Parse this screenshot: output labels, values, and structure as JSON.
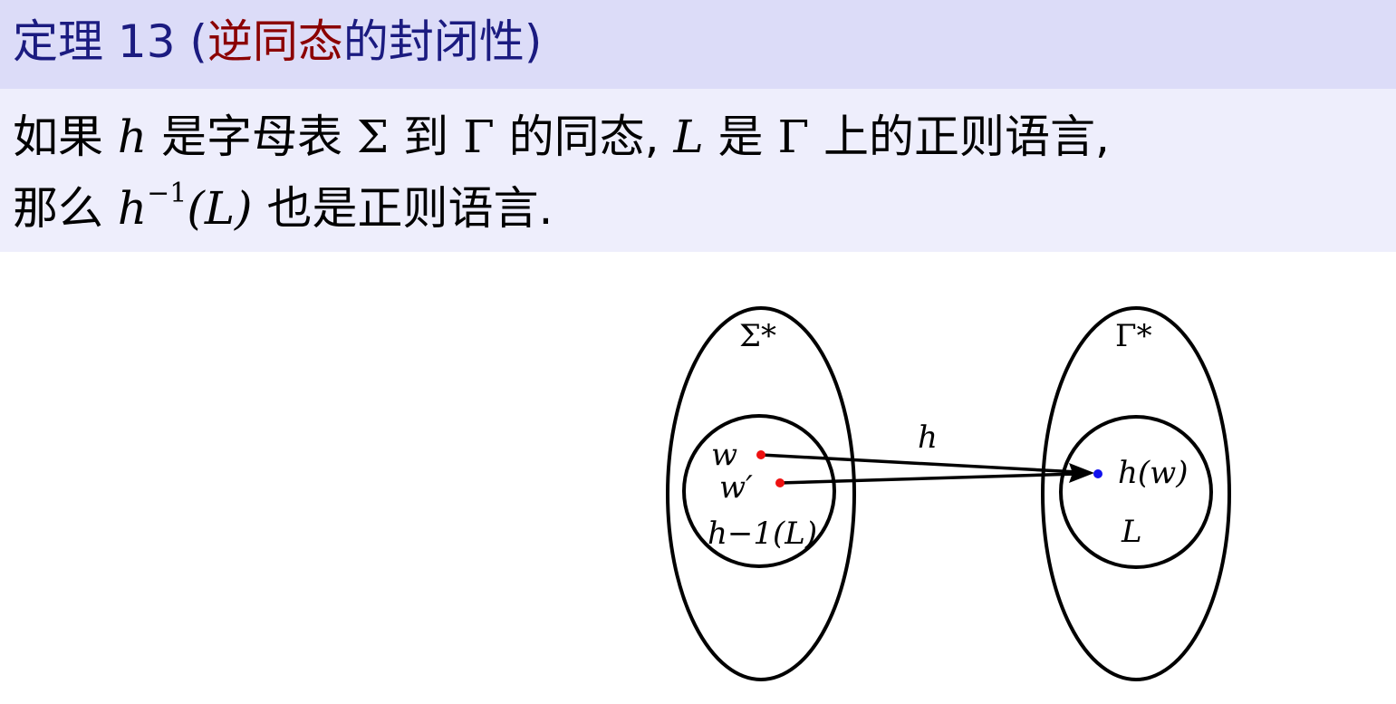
{
  "title": {
    "prefix": "定理 13 (",
    "highlight": "逆同态",
    "suffix": "的封闭性)"
  },
  "statement": {
    "line1": [
      {
        "t": "如果 ",
        "k": "text"
      },
      {
        "t": "h",
        "k": "math"
      },
      {
        "t": " 是字母表 ",
        "k": "text"
      },
      {
        "t": "Σ",
        "k": "greek"
      },
      {
        "t": " 到 ",
        "k": "text"
      },
      {
        "t": "Γ",
        "k": "greek"
      },
      {
        "t": " 的同态, ",
        "k": "text"
      },
      {
        "t": "L",
        "k": "math"
      },
      {
        "t": " 是 ",
        "k": "text"
      },
      {
        "t": "Γ",
        "k": "greek"
      },
      {
        "t": " 上的正则语言,",
        "k": "text"
      }
    ],
    "line2_prefix": "那么 ",
    "line2_h": "h",
    "line2_exp": "−1",
    "line2_arg": "(L)",
    "line2_suffix": " 也是正则语言."
  },
  "diagram": {
    "left_set_label": "Σ*",
    "right_set_label": "Γ*",
    "left_inner_label": "h−1(L)",
    "right_inner_label": "L",
    "arrow_label": "h",
    "point_w": "w",
    "point_w_prime": "w′",
    "image_point": "h(w)",
    "colors": {
      "source_points": "#ee1111",
      "image_point": "#1111ee"
    }
  }
}
